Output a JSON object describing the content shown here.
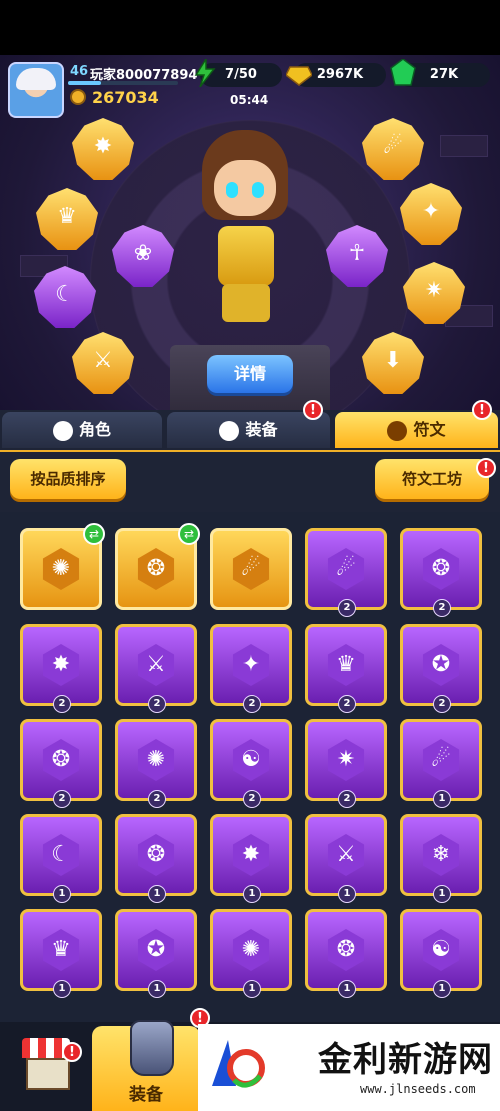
{
  "player": {
    "level": "46",
    "name": "玩家800077894",
    "xp_fraction": 0.3,
    "power": "267034",
    "timer": "05:44"
  },
  "resources": [
    {
      "name": "stamina",
      "value": "7/50",
      "color": "#2fbf3c",
      "icon": "energy-bolt-icon"
    },
    {
      "name": "gold",
      "value": "2967K",
      "color": "#f0c020",
      "icon": "gold-coin-icon"
    },
    {
      "name": "gems",
      "value": "27K",
      "color": "#22cc55",
      "icon": "green-gem-icon"
    }
  ],
  "scene": {
    "detail_button": "详情"
  },
  "tabs": [
    {
      "label": "角色",
      "active": false,
      "badge": ""
    },
    {
      "label": "装备",
      "active": false,
      "badge": "!"
    },
    {
      "label": "符文",
      "active": true,
      "badge": "!"
    }
  ],
  "toolbar": {
    "sort_label": "按品质排序",
    "workshop_label": "符文工坊",
    "workshop_badge": "!"
  },
  "runes": [
    [
      {
        "tier": "gold",
        "count": "",
        "swap": true,
        "glyph": "✺"
      },
      {
        "tier": "gold",
        "count": "",
        "swap": true,
        "glyph": "❂"
      },
      {
        "tier": "gold",
        "count": "",
        "swap": false,
        "glyph": "☄"
      },
      {
        "tier": "purple",
        "count": "2",
        "swap": false,
        "glyph": "☄"
      },
      {
        "tier": "purple",
        "count": "2",
        "swap": false,
        "glyph": "❂"
      }
    ],
    [
      {
        "tier": "purple",
        "count": "2",
        "glyph": "✸"
      },
      {
        "tier": "purple",
        "count": "2",
        "glyph": "⚔"
      },
      {
        "tier": "purple",
        "count": "2",
        "glyph": "✦"
      },
      {
        "tier": "purple",
        "count": "2",
        "glyph": "♛"
      },
      {
        "tier": "purple",
        "count": "2",
        "glyph": "✪"
      }
    ],
    [
      {
        "tier": "purple",
        "count": "2",
        "glyph": "❂"
      },
      {
        "tier": "purple",
        "count": "2",
        "glyph": "✺"
      },
      {
        "tier": "purple",
        "count": "2",
        "glyph": "☯"
      },
      {
        "tier": "purple",
        "count": "2",
        "glyph": "✷"
      },
      {
        "tier": "purple",
        "count": "1",
        "glyph": "☄"
      }
    ],
    [
      {
        "tier": "purple",
        "count": "1",
        "glyph": "☾"
      },
      {
        "tier": "purple",
        "count": "1",
        "glyph": "❂"
      },
      {
        "tier": "purple",
        "count": "1",
        "glyph": "✸"
      },
      {
        "tier": "purple",
        "count": "1",
        "glyph": "⚔"
      },
      {
        "tier": "purple",
        "count": "1",
        "glyph": "❄"
      }
    ],
    [
      {
        "tier": "purple",
        "count": "1",
        "glyph": "♛"
      },
      {
        "tier": "purple",
        "count": "1",
        "glyph": "✪"
      },
      {
        "tier": "purple",
        "count": "1",
        "glyph": "✺"
      },
      {
        "tier": "purple",
        "count": "1",
        "glyph": "❂"
      },
      {
        "tier": "purple",
        "count": "1",
        "glyph": "☯"
      }
    ]
  ],
  "equipped_slots": [
    {
      "tier": "gold",
      "glyph": "✸"
    },
    {
      "tier": "gold",
      "glyph": "♛"
    },
    {
      "tier": "purple",
      "glyph": "☾"
    },
    {
      "tier": "gold",
      "glyph": "⚔"
    },
    {
      "tier": "purple",
      "glyph": "❀"
    },
    {
      "tier": "purple",
      "glyph": "☥"
    },
    {
      "tier": "gold",
      "glyph": "☄"
    },
    {
      "tier": "gold",
      "glyph": "✦"
    },
    {
      "tier": "gold",
      "glyph": "✷"
    },
    {
      "tier": "gold",
      "glyph": "⬇"
    }
  ],
  "bottom_nav": {
    "equip_label": "装备",
    "shop_badge": "!",
    "equip_badge": "!"
  },
  "watermark": {
    "title": "金利新游网",
    "url": "www.jlnseeds.com"
  }
}
